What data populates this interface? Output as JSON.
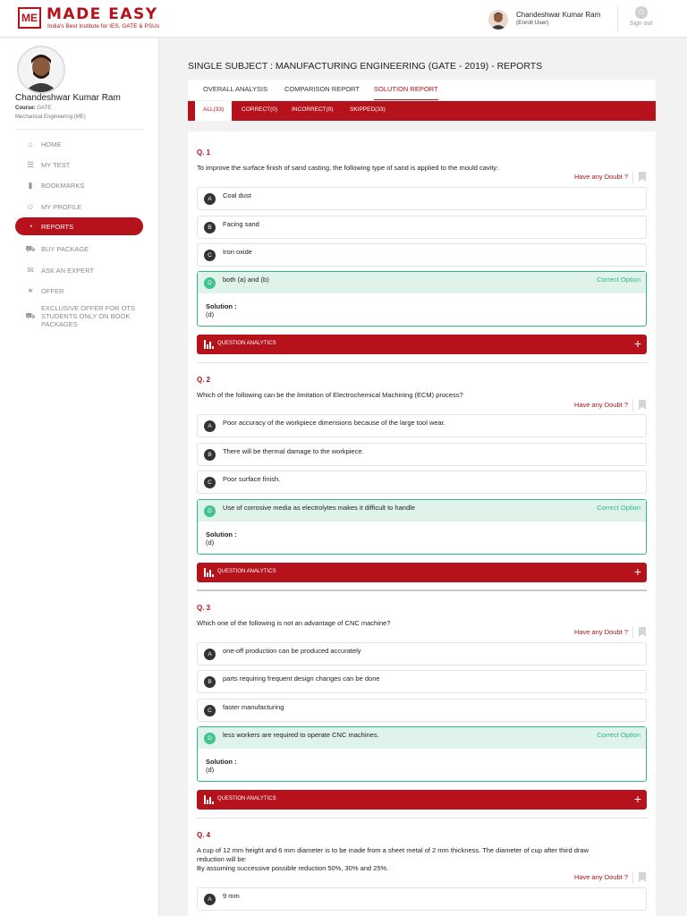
{
  "header": {
    "logo_mark": "ME",
    "brand": "MADE EASY",
    "tagline": "India's Best Institute for IES, GATE & PSUs",
    "user_name": "Chandeshwar Kumar Ram",
    "user_role": "(Enroll User)",
    "signout_label": "Sign out"
  },
  "profile": {
    "name": "Chandeshwar Kumar Ram",
    "course_label": "Course:",
    "course_value": "GATE",
    "branch": "Mechanical Engineering (ME)"
  },
  "sidebar": {
    "items": [
      {
        "label": "HOME",
        "icon": "home-icon"
      },
      {
        "label": "MY TEST",
        "icon": "test-icon"
      },
      {
        "label": "BOOKMARKS",
        "icon": "bookmark-icon"
      },
      {
        "label": "MY PROFILE",
        "icon": "user-icon"
      },
      {
        "label": "REPORTS",
        "icon": "reports-icon",
        "active": true
      },
      {
        "label": "BUY PACKAGE",
        "icon": "cart-icon"
      },
      {
        "label": "ASK AN EXPERT",
        "icon": "expert-icon"
      },
      {
        "label": "OFFER",
        "icon": "offer-icon"
      },
      {
        "label": "EXCLUSIVE OFFER FOR OTS STUDENTS ONLY ON BOOK PACKAGES",
        "icon": "cart-icon"
      }
    ]
  },
  "main": {
    "title": "SINGLE SUBJECT : MANUFACTURING ENGINEERING (GATE - 2019) - REPORTS",
    "tabs": [
      "OVERALL ANALYSIS",
      "COMPARISON REPORT",
      "SOLUTION REPORT"
    ],
    "active_tab": "SOLUTION REPORT",
    "subtabs": [
      "ALL(33)",
      "CORRECT(0)",
      "INCORRECT(0)",
      "SKIPPED(33)"
    ],
    "doubt_label": "Have any Doubt ?",
    "correct_label": "Correct Option",
    "solution_label": "Solution :",
    "analytics_label": "QUESTION ANALYTICS",
    "colors": {
      "accent": "#b5121b",
      "correct": "#2eb887",
      "correct_bg": "#dff3ea"
    }
  },
  "questions": [
    {
      "num": "Q. 1",
      "text": "To improve the surface finish of sand casting, the following type of sand is applied to the mould cavity:",
      "options": [
        {
          "letter": "A",
          "text": "Coal dust"
        },
        {
          "letter": "B",
          "text": "Facing sand"
        },
        {
          "letter": "C",
          "text": "Iron oxide"
        },
        {
          "letter": "D",
          "text": "both (a) and (b)",
          "correct": true
        }
      ],
      "solution": "(d)"
    },
    {
      "num": "Q. 2",
      "text": "Which of the following can be the limitation of Electrochemical Machining (ECM) process?",
      "options": [
        {
          "letter": "A",
          "text": "Poor accuracy of the workpiece dimensions because of the large tool wear."
        },
        {
          "letter": "B",
          "text": "There will be thermal damage to the workpiece."
        },
        {
          "letter": "C",
          "text": "Poor surface finish."
        },
        {
          "letter": "D",
          "text": "Use of corrosive media as electrolytes makes it difficult to handle",
          "correct": true
        }
      ],
      "solution": "(d)"
    },
    {
      "num": "Q. 3",
      "text": "Which one of the following is not an advantage of CNC machine?",
      "options": [
        {
          "letter": "A",
          "text": "one-off production can be produced accurately"
        },
        {
          "letter": "B",
          "text": "parts requiring frequent design changes can be done"
        },
        {
          "letter": "C",
          "text": "faster manufacturing"
        },
        {
          "letter": "D",
          "text": "less workers are required to operate CNC machines.",
          "correct": true
        }
      ],
      "solution": "(d)"
    },
    {
      "num": "Q. 4",
      "text_lines": [
        "A cup of 12 mm height and 6 mm diameter is to be made from a sheet metal of 2 mm thickness. The diameter of cup after third draw",
        "reduction will be:",
        "By assuming successive possible reduction 50%, 30% and 25%."
      ],
      "options": [
        {
          "letter": "A",
          "text": "9 mm"
        }
      ]
    }
  ]
}
